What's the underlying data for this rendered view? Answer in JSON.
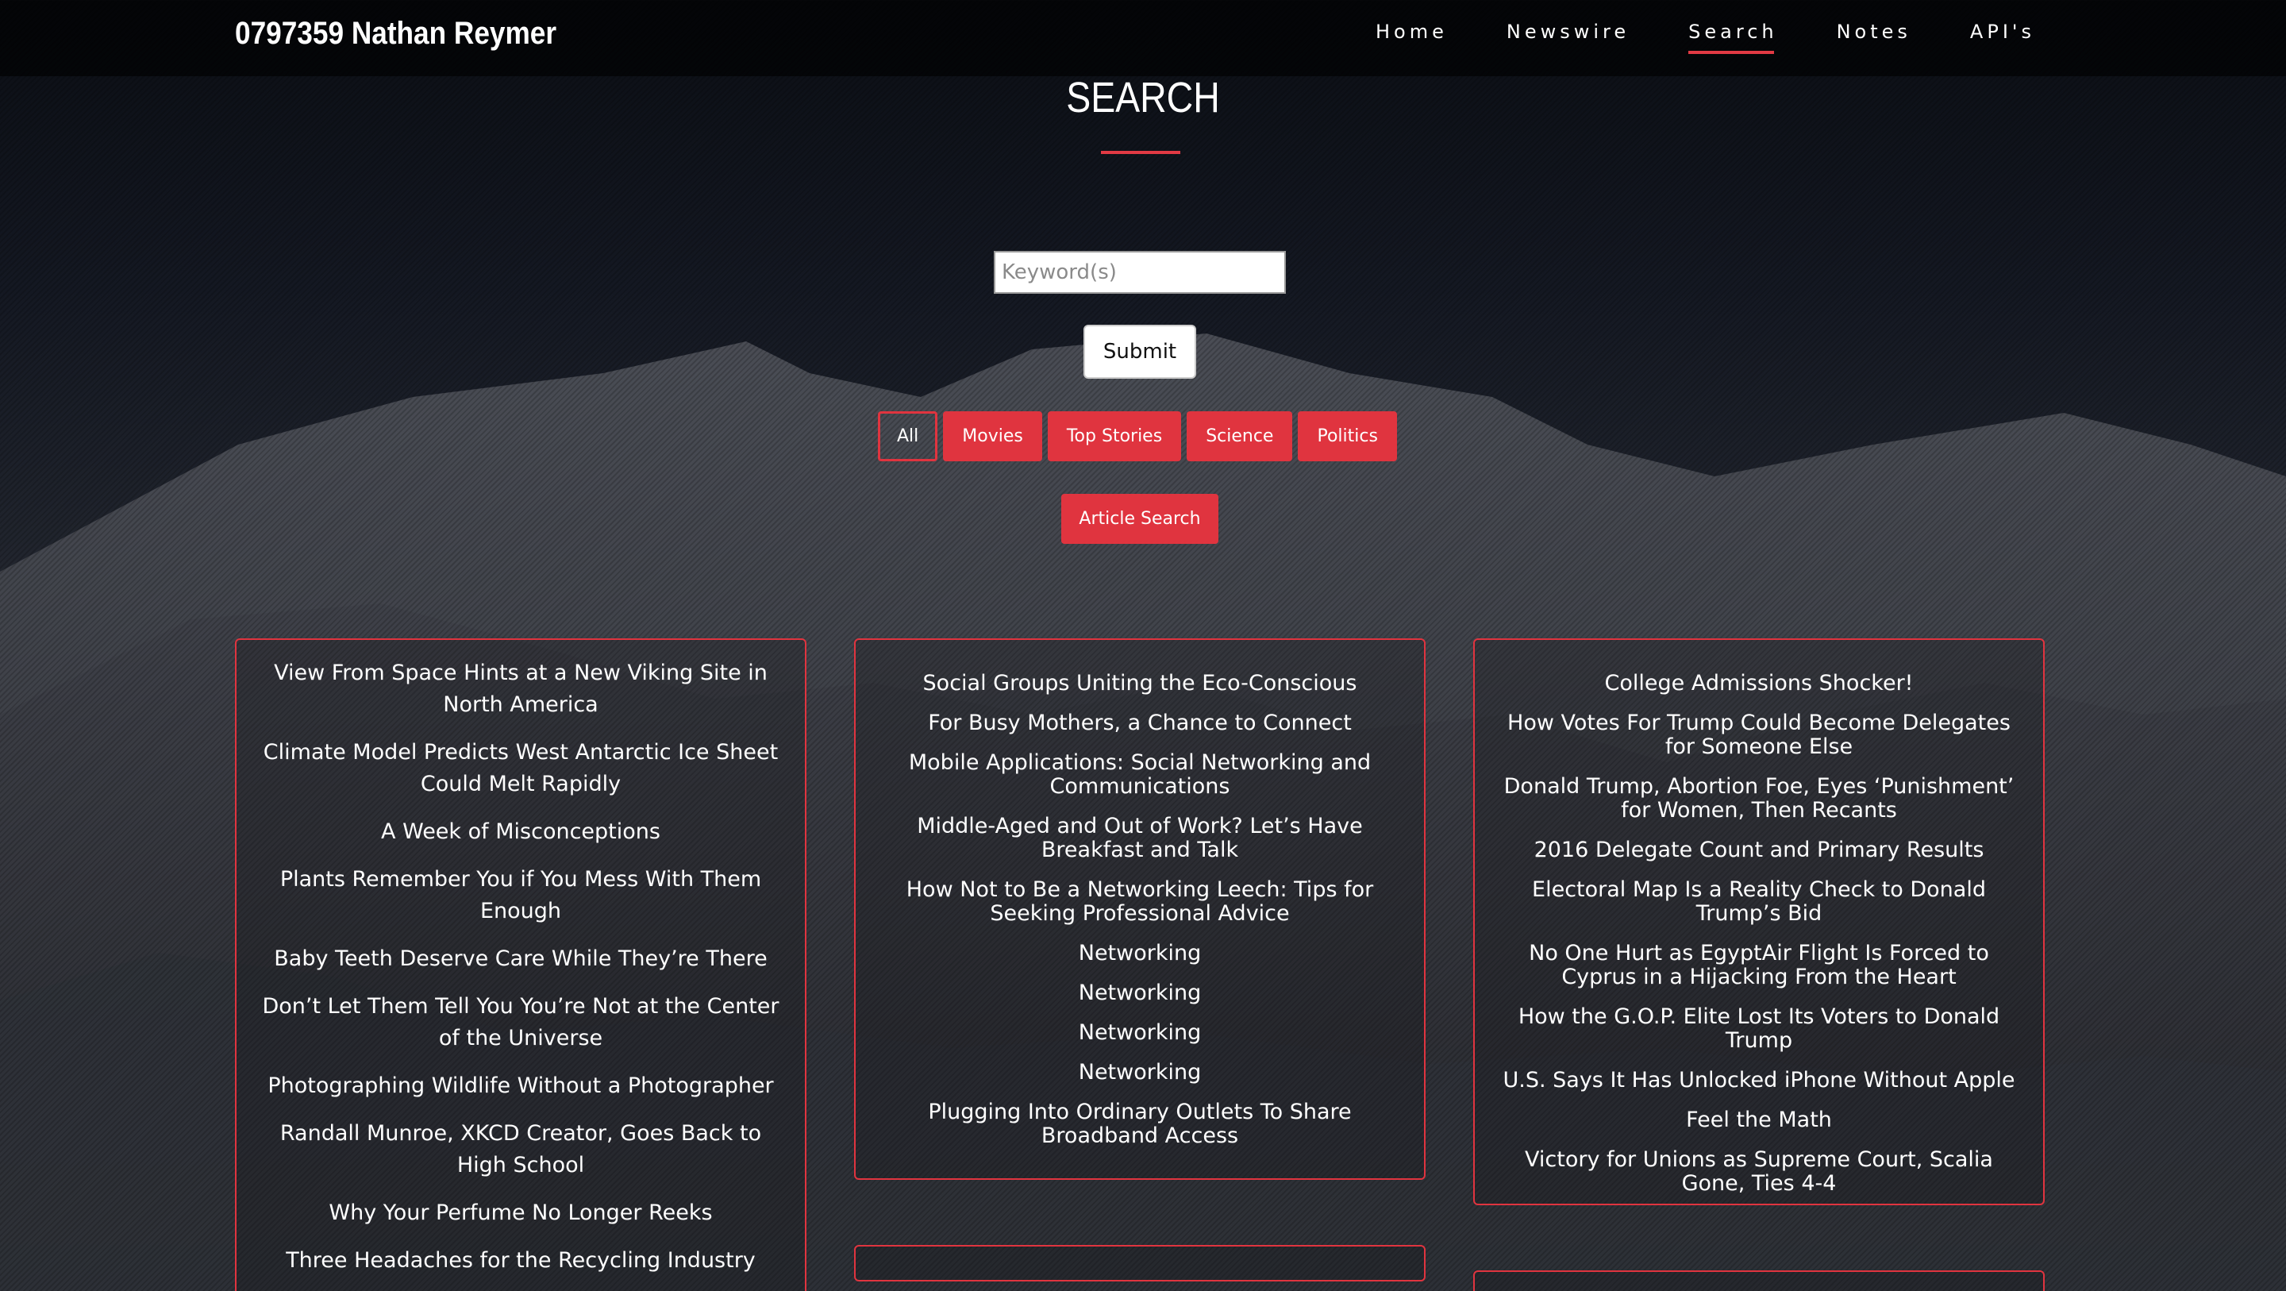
{
  "brand": "0797359 Nathan Reymer",
  "nav": {
    "items": [
      "Home",
      "Newswire",
      "Search",
      "Notes",
      "API's"
    ],
    "active": "Search"
  },
  "page": {
    "title": "SEARCH"
  },
  "search": {
    "placeholder": "Keyword(s)",
    "value": "",
    "submit_label": "Submit"
  },
  "filters": {
    "items": [
      "All",
      "Movies",
      "Top Stories",
      "Science",
      "Politics"
    ],
    "selected": "All"
  },
  "article_search_label": "Article Search",
  "colors": {
    "accent": "#e0343f",
    "nav_bg": "#000000"
  },
  "columns": [
    {
      "items": [
        "View From Space Hints at a New Viking Site in North America",
        "Climate Model Predicts West Antarctic Ice Sheet Could Melt Rapidly",
        "A Week of Misconceptions",
        "Plants Remember You if You Mess With Them Enough",
        "Baby Teeth Deserve Care While They’re There",
        "Don’t Let Them Tell You You’re Not at the Center of the Universe",
        "Photographing Wildlife Without a Photographer",
        "Randall Munroe, XKCD Creator, Goes Back to High School",
        "Why Your Perfume No Longer Reeks",
        "Three Headaches for the Recycling Industry"
      ]
    },
    {
      "items": [
        "Social Groups Uniting the Eco-Conscious",
        "For Busy Mothers, a Chance to Connect",
        "Mobile Applications: Social Networking and Communications",
        "Middle-Aged and Out of Work? Let’s Have Breakfast and Talk",
        "How Not to Be a Networking Leech: Tips for Seeking Professional Advice",
        "Networking",
        "Networking",
        "Networking",
        "Networking",
        "Plugging Into Ordinary Outlets To Share Broadband Access"
      ]
    },
    {
      "items": [
        "College Admissions Shocker!",
        "How Votes For Trump Could Become Delegates for Someone Else",
        "Donald Trump, Abortion Foe, Eyes ‘Punishment’ for Women, Then Recants",
        "2016 Delegate Count and Primary Results",
        "Electoral Map Is a Reality Check to Donald Trump’s Bid",
        "No One Hurt as EgyptAir Flight Is Forced to Cyprus in a Hijacking From the Heart",
        "How the G.O.P. Elite Lost Its Voters to Donald Trump",
        "U.S. Says It Has Unlocked iPhone Without Apple",
        "Feel the Math",
        "Victory for Unions as Supreme Court, Scalia Gone, Ties 4-4"
      ]
    }
  ]
}
